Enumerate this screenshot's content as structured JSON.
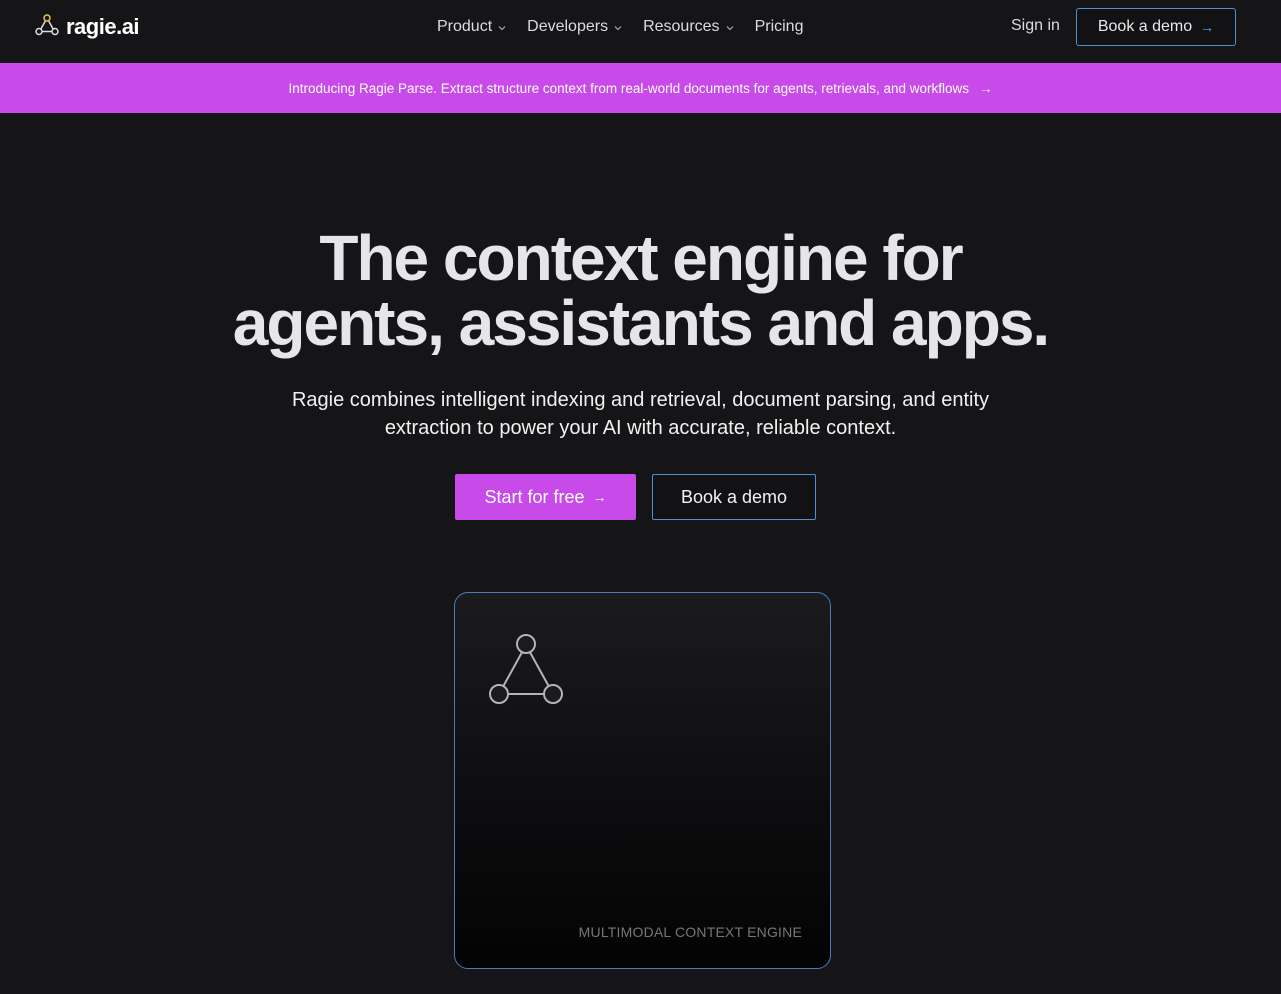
{
  "nav": {
    "logo_text": "ragie.ai",
    "logo_icon": "triangle-nodes-icon",
    "menu": [
      {
        "label": "Product",
        "has_dropdown": true
      },
      {
        "label": "Developers",
        "has_dropdown": true
      },
      {
        "label": "Resources",
        "has_dropdown": true
      },
      {
        "label": "Pricing",
        "has_dropdown": false
      }
    ],
    "signin_label": "Sign in",
    "demo_label": "Book a demo",
    "demo_icon": "arrow-right-icon"
  },
  "banner": {
    "text": "Introducing Ragie Parse. Extract structure context from real-world documents for agents, retrievals, and workflows",
    "icon": "arrow-right-icon"
  },
  "hero": {
    "title_line1": "The context engine for",
    "title_line2": "agents, assistants and apps.",
    "subtitle_line1": "Ragie combines intelligent indexing and retrieval, document parsing, and entity",
    "subtitle_line2": "extraction to power your AI with accurate, reliable context.",
    "cta_primary_label": "Start for free",
    "cta_secondary_label": "Book a demo"
  },
  "card": {
    "icon": "triangle-nodes-icon",
    "label": "MULTIMODAL CONTEXT ENGINE"
  },
  "colors": {
    "background": "#151517",
    "accent_purple": "#c84ae9",
    "outline_blue": "#4f8fd6",
    "text_primary": "#e6e6e8"
  }
}
